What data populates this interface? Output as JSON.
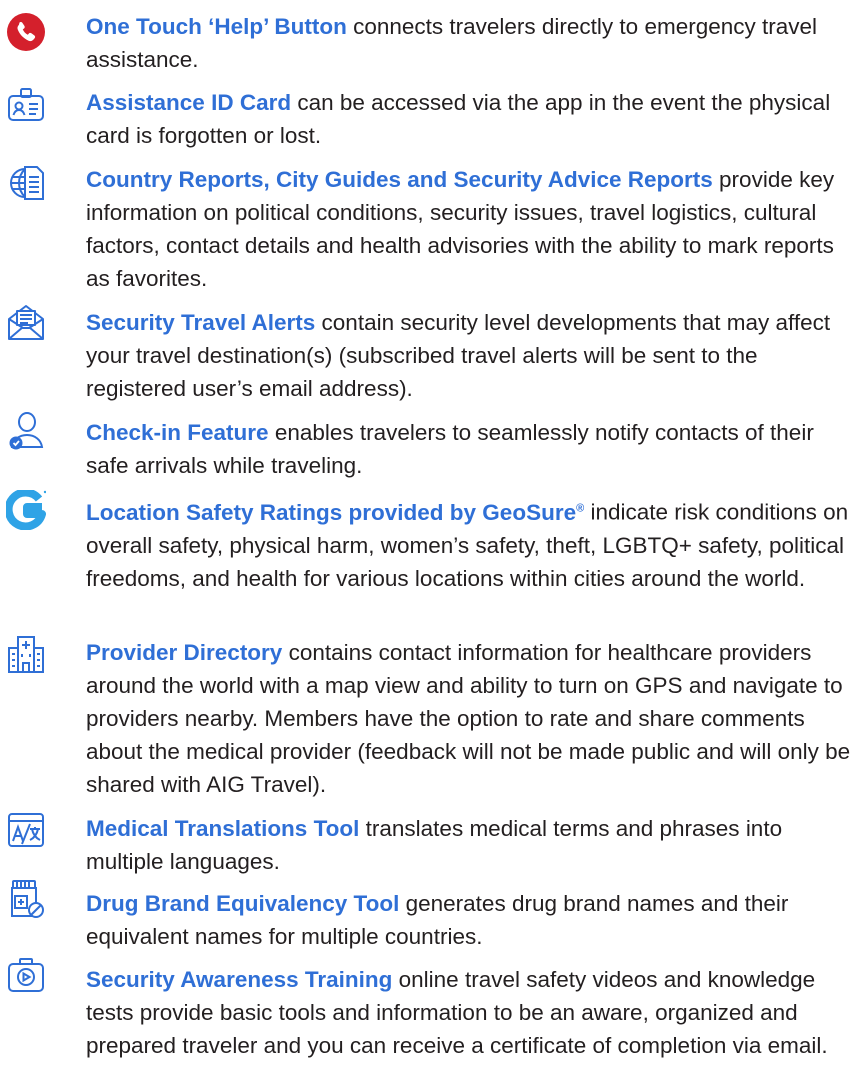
{
  "features": [
    {
      "icon": "phone-icon",
      "title": "One Touch ‘Help’ Button",
      "desc": " connects travelers directly to emergency travel assistance."
    },
    {
      "icon": "id-card-icon",
      "title": "Assistance ID Card",
      "desc": " can be accessed via the app in the event the physical card is forgotten or lost."
    },
    {
      "icon": "globe-document-icon",
      "title": "Country Reports, City Guides and Security Advice Reports",
      "desc": " provide key information on political conditions, security issues, travel logistics, cultural factors, contact details and health advisories with the ability to mark reports as favorites."
    },
    {
      "icon": "envelope-icon",
      "title": "Security Travel Alerts",
      "desc": " contain security level developments that may affect your travel destination(s) (subscribed travel alerts will be sent to the registered user’s email address)."
    },
    {
      "icon": "user-check-icon",
      "title": "Check-in Feature",
      "desc": " enables travelers to seamlessly notify contacts of their safe arrivals while traveling."
    },
    {
      "icon": "geosure-logo-icon",
      "title": "Location Safety Ratings provided by GeoSure",
      "sup": "®",
      "desc": " indicate risk conditions on overall safety, physical harm, women’s safety, theft, LGBTQ+ safety, political freedoms, and health for various locations within cities around the world."
    },
    {
      "icon": "hospital-icon",
      "title": "Provider Directory",
      "desc": " contains contact information for healthcare providers around the world with a map view and ability to turn on GPS and navigate to providers nearby. Members have the option to rate and share comments about the medical provider (feedback will not be made public and will only be shared with AIG Travel)."
    },
    {
      "icon": "translate-icon",
      "title": "Medical Translations Tool",
      "desc": " translates medical terms and phrases into multiple languages."
    },
    {
      "icon": "pill-bottle-icon",
      "title": "Drug Brand Equivalency Tool",
      "desc": " generates drug brand names and their equivalent names for multiple countries."
    },
    {
      "icon": "video-play-icon",
      "title": "Security Awareness Training",
      "desc": " online travel safety videos and knowledge tests provide basic tools and information to be an aware, organized and prepared traveler and you can receive a certificate of completion via email."
    }
  ],
  "colors": {
    "accent": "#2f6fd6",
    "phone": "#d4202c",
    "geosure": "#2fa3e6",
    "text": "#231f20"
  }
}
